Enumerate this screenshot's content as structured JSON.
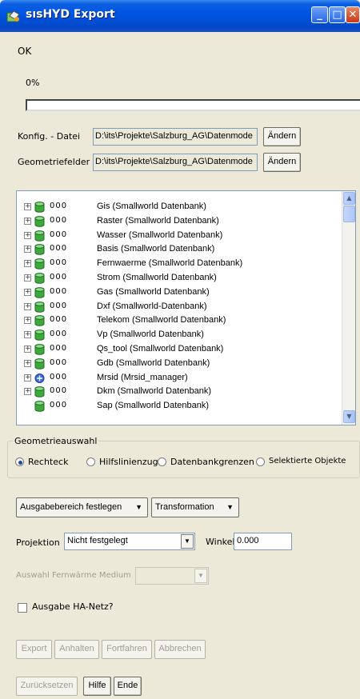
{
  "window": {
    "title": "sısHYD Export"
  },
  "status": {
    "message": "OK",
    "percent_label": "0%",
    "progress": 0
  },
  "config": {
    "konfig_label": "Konfig. - Datei",
    "konfig_value": "D:\\its\\Projekte\\Salzburg_AG\\Datenmode",
    "geometrie_label": "Geometriefelder",
    "geometrie_value": "D:\\its\\Projekte\\Salzburg_AG\\Datenmode",
    "change_label": "Ändern"
  },
  "tree": {
    "items": [
      {
        "code": "000",
        "name": "Gis (Smallworld Datenbank)",
        "icon": "database-icon",
        "expandable": true
      },
      {
        "code": "000",
        "name": "Raster (Smallworld Datenbank)",
        "icon": "database-icon",
        "expandable": true
      },
      {
        "code": "000",
        "name": "Wasser (Smallworld Datenbank)",
        "icon": "database-icon",
        "expandable": true
      },
      {
        "code": "000",
        "name": "Basis (Smallworld Datenbank)",
        "icon": "database-icon",
        "expandable": true
      },
      {
        "code": "000",
        "name": "Fernwaerme (Smallworld Datenbank)",
        "icon": "database-icon",
        "expandable": true
      },
      {
        "code": "000",
        "name": "Strom (Smallworld Datenbank)",
        "icon": "database-icon",
        "expandable": true
      },
      {
        "code": "000",
        "name": "Gas (Smallworld Datenbank)",
        "icon": "database-icon",
        "expandable": true
      },
      {
        "code": "000",
        "name": "Dxf (Smallworld-Datenbank)",
        "icon": "database-icon",
        "expandable": true
      },
      {
        "code": "000",
        "name": "Telekom (Smallworld Datenbank)",
        "icon": "database-icon",
        "expandable": true
      },
      {
        "code": "000",
        "name": "Vp (Smallworld Datenbank)",
        "icon": "database-icon",
        "expandable": true
      },
      {
        "code": "000",
        "name": "Qs_tool (Smallworld Datenbank)",
        "icon": "database-icon",
        "expandable": true
      },
      {
        "code": "000",
        "name": "Gdb (Smallworld Datenbank)",
        "icon": "database-icon",
        "expandable": true
      },
      {
        "code": "000",
        "name": "Mrsid (Mrsid_manager)",
        "icon": "image-manager-icon",
        "expandable": true
      },
      {
        "code": "000",
        "name": "Dkm (Smallworld Datenbank)",
        "icon": "database-icon",
        "expandable": true
      },
      {
        "code": "000",
        "name": "Sap (Smallworld Datenbank)",
        "icon": "database-icon",
        "expandable": false
      }
    ]
  },
  "geometry": {
    "legend": "Geometrieauswahl",
    "options": [
      "Rechteck",
      "Hilfslinienzug",
      "Datenbankgrenzen",
      "Selektierte Objekte"
    ],
    "selected": "Rechteck"
  },
  "actions": {
    "ausgabebereich": "Ausgabebereich festlegen",
    "transformation": "Transformation"
  },
  "projection": {
    "label": "Projektion",
    "value": "Nicht festgelegt",
    "winkel_label": "Winkel",
    "winkel_value": "0.000"
  },
  "fernwaerme": {
    "label": "Auswahl Fernwärme Medium",
    "value": ""
  },
  "ha_netz": {
    "label": "Ausgabe HA-Netz?",
    "checked": false
  },
  "buttons": {
    "export": "Export",
    "anhalten": "Anhalten",
    "fortfahren": "Fortfahren",
    "abbrechen": "Abbrechen",
    "zuruecksetzen": "Zurücksetzen",
    "hilfe": "Hilfe",
    "ende": "Ende"
  },
  "colors": {
    "titlebar": "#0054e3",
    "dialog_bg": "#ece9d8",
    "db_icon": "#2b8a3e"
  }
}
